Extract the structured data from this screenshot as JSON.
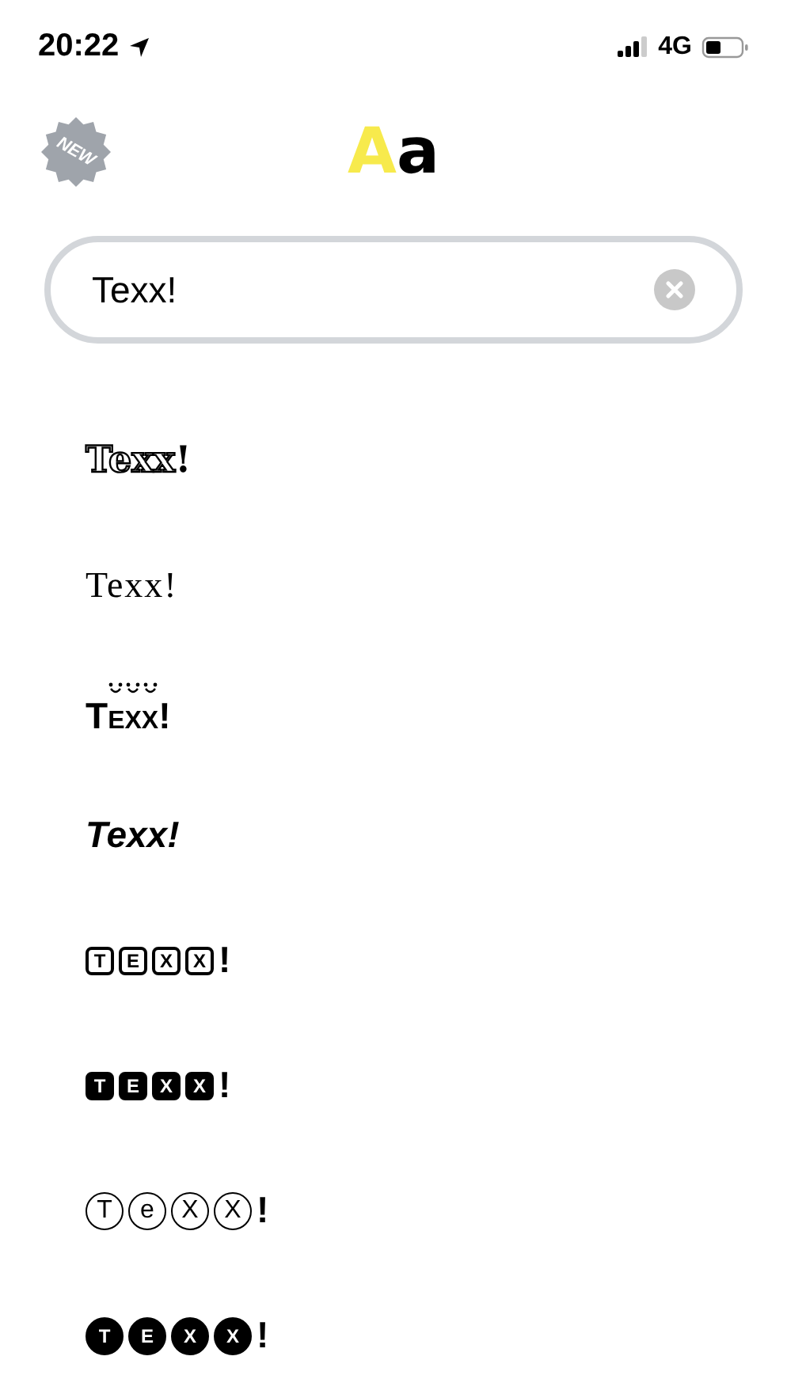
{
  "status_bar": {
    "time": "20:22",
    "network": "4G"
  },
  "header": {
    "badge": "NEW",
    "logo": "Aa"
  },
  "search": {
    "value": "Texx!"
  },
  "styles": [
    {
      "kind": "double-struck",
      "text": "Texx!"
    },
    {
      "kind": "monospace",
      "text": "Texx!"
    },
    {
      "kind": "umlaut",
      "text": "Texx!"
    },
    {
      "kind": "italic",
      "text": "Texx!"
    },
    {
      "kind": "boxed",
      "tiles": [
        "T",
        "E",
        "X",
        "X"
      ],
      "suffix": "!"
    },
    {
      "kind": "boxed-filled",
      "tiles": [
        "T",
        "E",
        "X",
        "X"
      ],
      "suffix": "!"
    },
    {
      "kind": "circled",
      "tiles": [
        "T",
        "e",
        "X",
        "X"
      ],
      "suffix": "!"
    },
    {
      "kind": "circled-filled",
      "tiles": [
        "T",
        "E",
        "X",
        "X"
      ],
      "suffix": "!"
    }
  ]
}
